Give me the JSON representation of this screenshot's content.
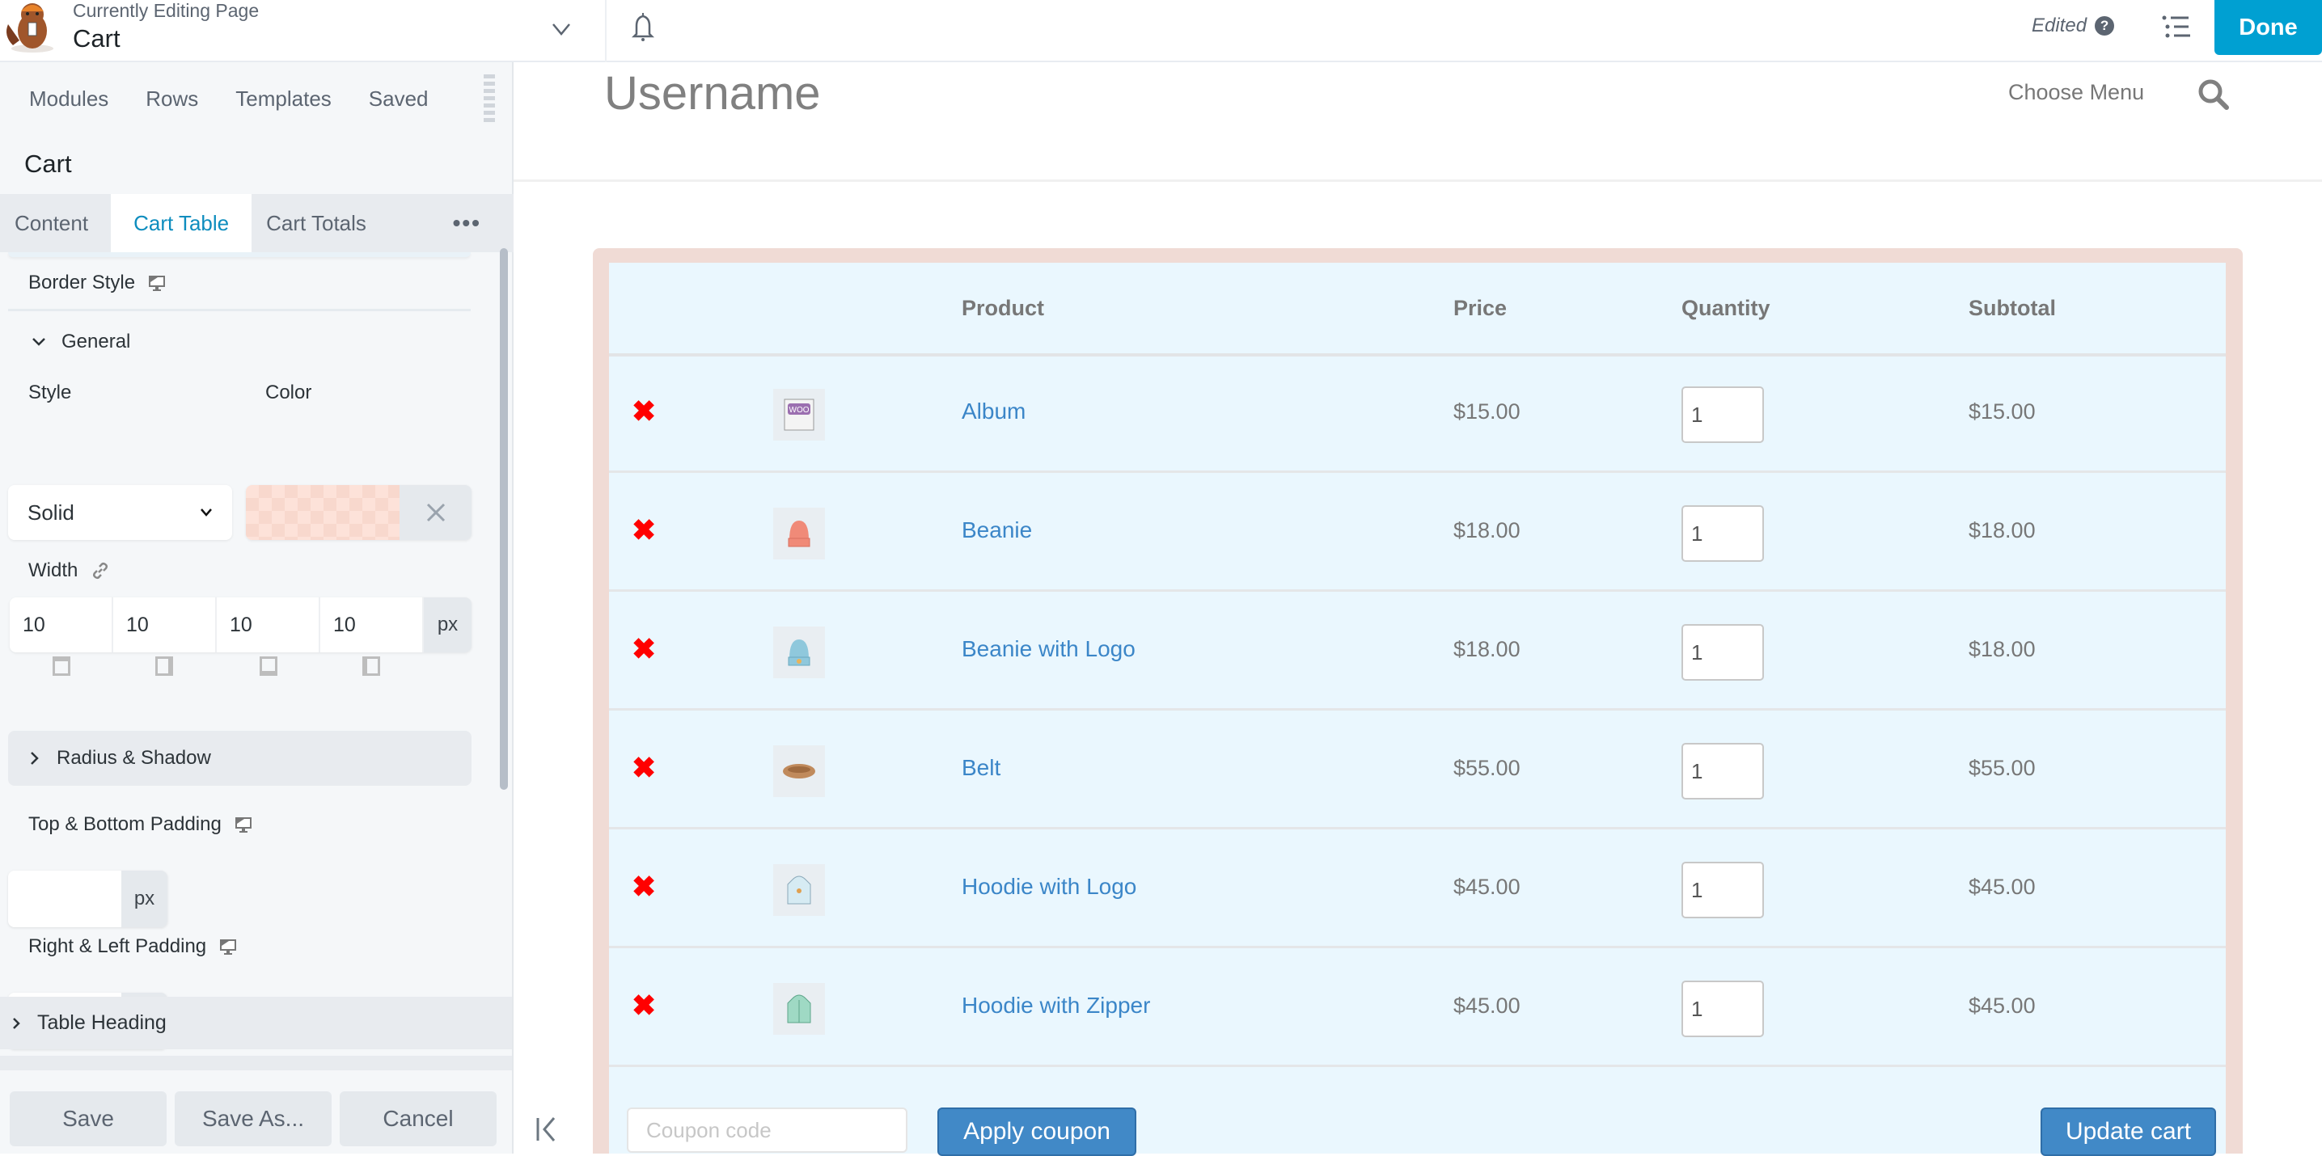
{
  "topbar": {
    "editing_label": "Currently Editing Page",
    "page_name": "Cart",
    "status": "Edited",
    "help_glyph": "?",
    "done_label": "Done",
    "icons": [
      "beaver-logo",
      "chevron-down-icon",
      "bell-icon",
      "help-icon",
      "outline-list-icon"
    ]
  },
  "panel": {
    "tabs": [
      "Modules",
      "Rows",
      "Templates",
      "Saved"
    ],
    "module_title": "Cart",
    "settings_tabs": [
      "Content",
      "Cart Table",
      "Cart Totals"
    ],
    "active_settings_tab": "Cart Table",
    "more_glyph": "•••",
    "border_style": {
      "label": "Border Style",
      "group": "General",
      "style_label": "Style",
      "style_value": "Solid",
      "color_label": "Color",
      "color_value": "#fde2d9",
      "width_label": "Width",
      "width_values": [
        "10",
        "10",
        "10",
        "10"
      ],
      "width_unit": "px"
    },
    "radius_shadow_label": "Radius & Shadow",
    "top_bottom_padding": {
      "label": "Top & Bottom Padding",
      "value": "",
      "unit": "px"
    },
    "right_left_padding": {
      "label": "Right & Left Padding",
      "value": "",
      "unit": "px"
    },
    "table_heading_label": "Table Heading",
    "footer": {
      "save": "Save",
      "save_as": "Save As...",
      "cancel": "Cancel"
    }
  },
  "site": {
    "title": "Username",
    "menu_label": "Choose Menu"
  },
  "cart": {
    "columns": [
      "",
      "",
      "Product",
      "Price",
      "Quantity",
      "Subtotal"
    ],
    "items": [
      {
        "name": "Album",
        "price": "$15.00",
        "quantity": "1",
        "subtotal": "$15.00",
        "thumb": "album"
      },
      {
        "name": "Beanie",
        "price": "$18.00",
        "quantity": "1",
        "subtotal": "$18.00",
        "thumb": "beanie"
      },
      {
        "name": "Beanie with Logo",
        "price": "$18.00",
        "quantity": "1",
        "subtotal": "$18.00",
        "thumb": "beanie-logo"
      },
      {
        "name": "Belt",
        "price": "$55.00",
        "quantity": "1",
        "subtotal": "$55.00",
        "thumb": "belt"
      },
      {
        "name": "Hoodie with Logo",
        "price": "$45.00",
        "quantity": "1",
        "subtotal": "$45.00",
        "thumb": "hoodie-logo"
      },
      {
        "name": "Hoodie with Zipper",
        "price": "$45.00",
        "quantity": "1",
        "subtotal": "$45.00",
        "thumb": "hoodie-zipper"
      }
    ],
    "remove_glyph": "✖",
    "coupon_placeholder": "Coupon code",
    "apply_coupon_label": "Apply coupon",
    "update_cart_label": "Update cart",
    "colors": {
      "border": "#f0dbd5",
      "background": "#eaf7fe",
      "link": "#3b86c8",
      "button": "#4189c7"
    }
  }
}
